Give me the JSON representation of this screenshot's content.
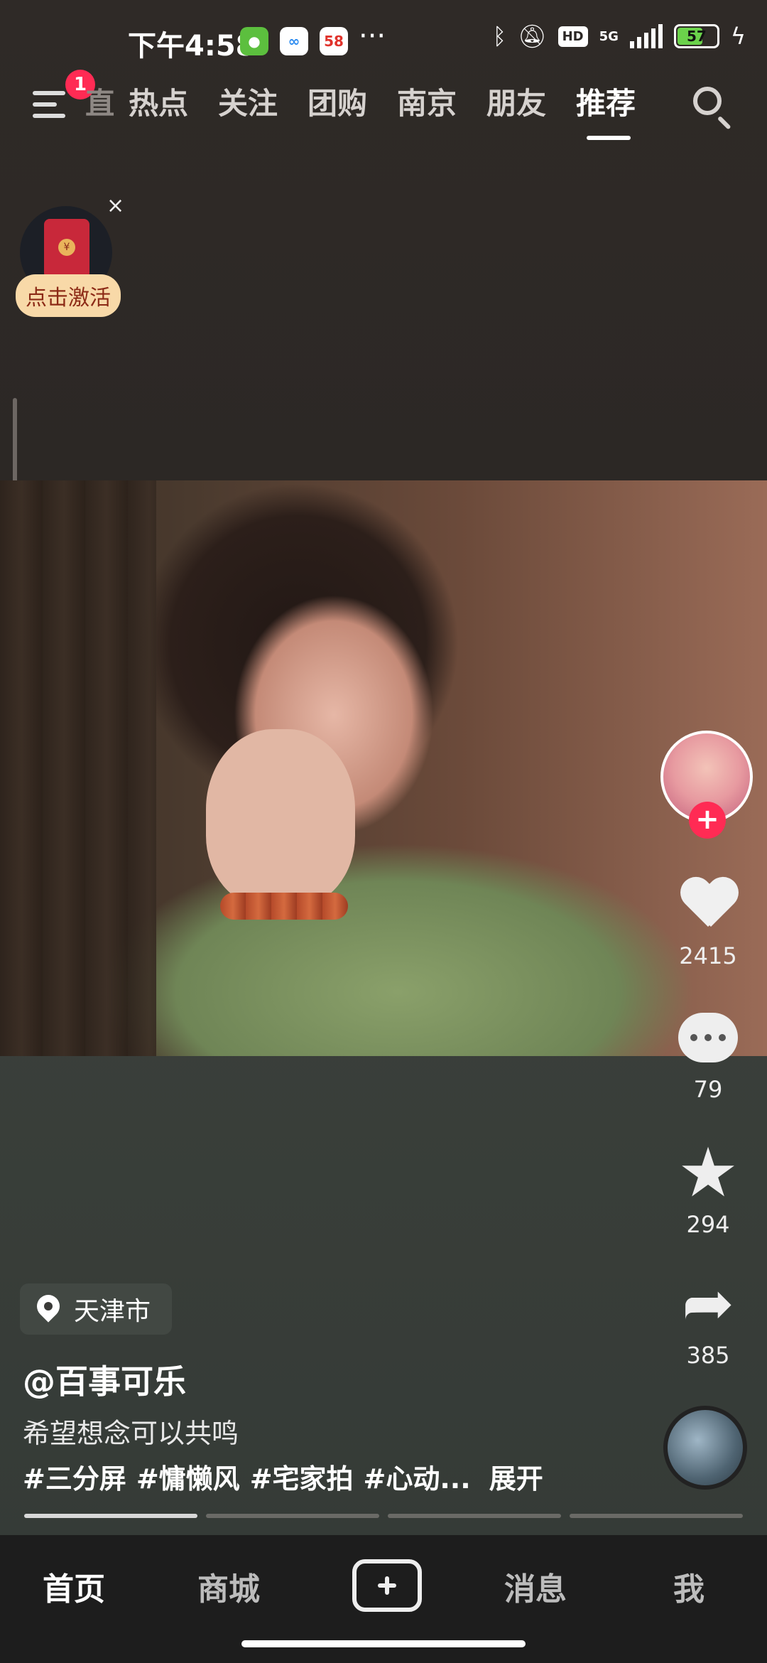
{
  "status_bar": {
    "time": "下午4:58",
    "app_badge_58": "58",
    "network": "5G",
    "hd_label": "HD",
    "battery": "57"
  },
  "top_nav": {
    "menu_badge": "1",
    "partial_tab": "直",
    "tabs": [
      "热点",
      "关注",
      "团购",
      "南京",
      "朋友",
      "推荐"
    ],
    "active_tab": "推荐"
  },
  "promo": {
    "close": "×",
    "label": "点击激活",
    "coin": "¥"
  },
  "video": {
    "likes": "2415",
    "comments": "79",
    "favorites": "294",
    "shares": "385",
    "follow_symbol": "+"
  },
  "caption": {
    "location": "天津市",
    "author": "@百事可乐",
    "description": "希望想念可以共鸣",
    "tags": [
      "#三分屏",
      "#慵懒风",
      "#宅家拍",
      "#心动..."
    ],
    "expand": "展开"
  },
  "bottom_nav": {
    "home": "首页",
    "mall": "商城",
    "messages": "消息",
    "me": "我"
  },
  "colors": {
    "accent": "#ff2b54",
    "promo_bg": "#f8d9a8"
  }
}
